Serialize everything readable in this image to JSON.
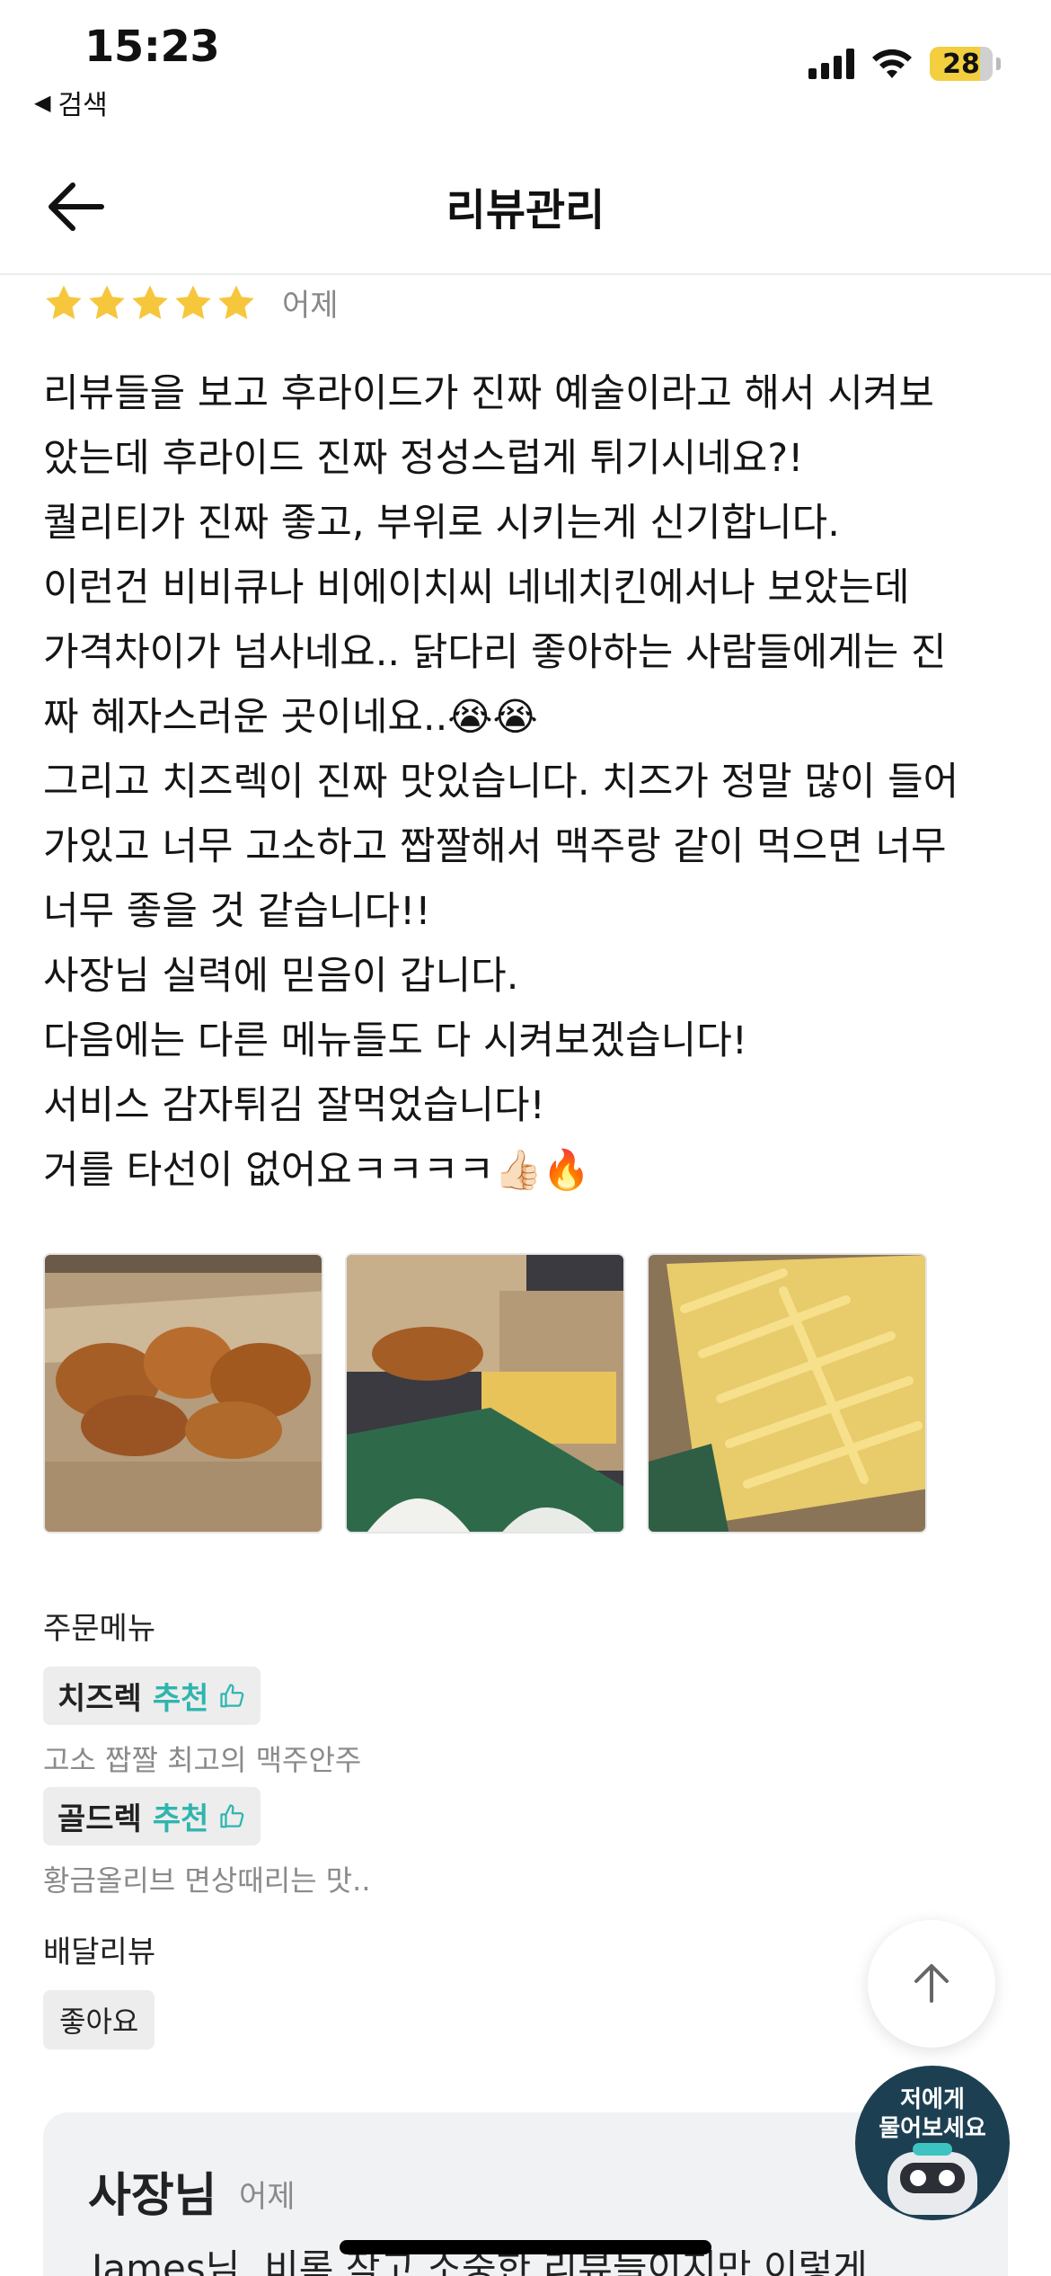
{
  "status_bar": {
    "time": "15:23",
    "back_app_label": "검색",
    "battery_level": "28",
    "icons": [
      "signal-icon",
      "wifi-icon",
      "battery-icon"
    ]
  },
  "header": {
    "title": "리뷰관리",
    "back_icon": "arrow-left-icon"
  },
  "review": {
    "rating": 5,
    "date": "어제",
    "lines": [
      "리뷰들을 보고 후라이드가 진짜 예술이라고 해서 시켜보",
      "았는데 후라이드 진짜 정성스럽게 튀기시네요?!",
      "퀄리티가 진짜 좋고, 부위로 시키는게 신기합니다.",
      "이런건 비비큐나 비에이치씨 네네치킨에서나 보았는데",
      "가격차이가 넘사네요.. 닭다리 좋아하는 사람들에게는 진",
      "짜 혜자스러운 곳이네요..😭😭",
      "그리고 치즈렉이 진짜 맛있습니다. 치즈가 정말 많이 들어",
      "가있고 너무 고소하고 짭짤해서 맥주랑 같이 먹으면 너무",
      "너무 좋을 것 같습니다!!",
      "사장님 실력에 믿음이 갑니다.",
      "다음에는 다른 메뉴들도 다 시켜보겠습니다!",
      "서비스 감자튀김 잘먹었습니다!",
      "거를 타선이 없어요ㅋㅋㅋㅋ👍🏻🔥"
    ],
    "photos": [
      "fried-chicken-photo",
      "chicken-and-fries-photo",
      "cheese-fries-photo"
    ]
  },
  "order_menu": {
    "label": "주문메뉴",
    "items": [
      {
        "name": "치즈렉",
        "recommend": "추천",
        "desc": "고소 짭짤 최고의 맥주안주"
      },
      {
        "name": "골드렉",
        "recommend": "추천",
        "desc": "황금올리브 면상때리는 맛.."
      }
    ]
  },
  "delivery_review": {
    "label": "배달리뷰",
    "tag": "좋아요"
  },
  "owner_reply": {
    "name": "사장님",
    "date": "어제",
    "text": "James님, 비록 작고 소중한 리뷰들이지만 이렇게"
  },
  "floating": {
    "scroll_top_icon": "arrow-up-icon",
    "ask_bot_label": "저에게\n물어보세요"
  },
  "colors": {
    "star": "#f6c63c",
    "recommend": "#2fb5ae",
    "owner_box": "#f1f2f4",
    "bot_bg": "#1d3f52"
  }
}
